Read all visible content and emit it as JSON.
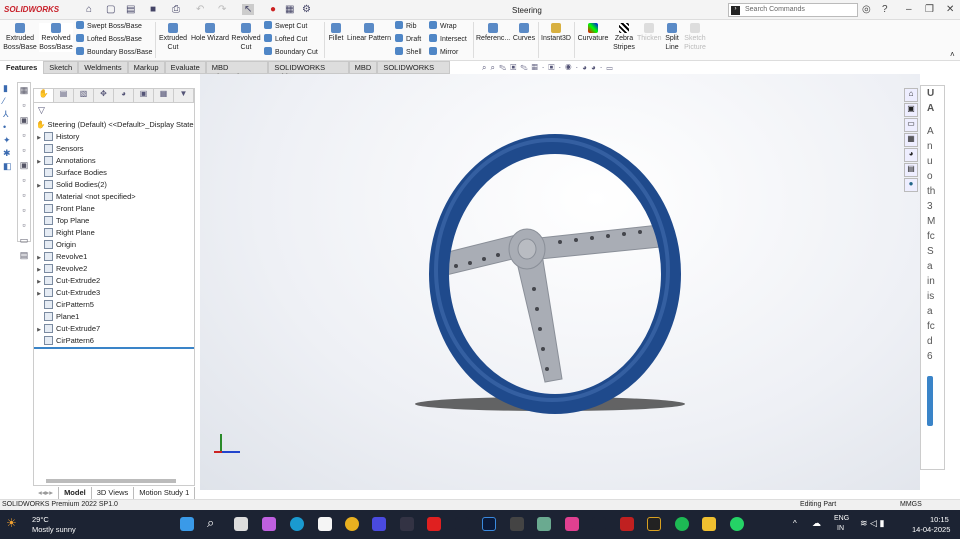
{
  "app": {
    "logo": "SOLIDWORKS",
    "title": "Steering",
    "search_placeholder": "Search Commands"
  },
  "ribbon": {
    "big": [
      "Extruded Boss/Base",
      "Revolved Boss/Base",
      "Extruded Cut",
      "Hole Wizard",
      "Revolved Cut",
      "Fillet",
      "Linear Pattern",
      "Referenc...",
      "Curves",
      "Instant3D",
      "Curvature",
      "Zebra Stripes",
      "Thicken",
      "Split Line",
      "Sketch Picture"
    ],
    "small": [
      "Swept Boss/Base",
      "Lofted Boss/Base",
      "Boundary Boss/Base",
      "Swept Cut",
      "Lofted Cut",
      "Boundary Cut",
      "Rib",
      "Draft",
      "Shell",
      "Wrap",
      "Intersect",
      "Mirror"
    ]
  },
  "tabs": [
    "Features",
    "Sketch",
    "Weldments",
    "Markup",
    "Evaluate",
    "MBD Dimensions",
    "SOLIDWORKS Add-Ins",
    "MBD",
    "SOLIDWORKS CAM"
  ],
  "tree": {
    "root": "Steering (Default) <<Default>_Display State",
    "nodes": [
      {
        "label": "History",
        "exp": true
      },
      {
        "label": "Sensors",
        "exp": false
      },
      {
        "label": "Annotations",
        "exp": true
      },
      {
        "label": "Surface Bodies",
        "exp": false
      },
      {
        "label": "Solid Bodies(2)",
        "exp": true
      },
      {
        "label": "Material <not specified>",
        "exp": false
      },
      {
        "label": "Front Plane",
        "exp": false
      },
      {
        "label": "Top Plane",
        "exp": false
      },
      {
        "label": "Right Plane",
        "exp": false
      },
      {
        "label": "Origin",
        "exp": false
      },
      {
        "label": "Revolve1",
        "exp": true
      },
      {
        "label": "Revolve2",
        "exp": true
      },
      {
        "label": "Cut-Extrude2",
        "exp": true
      },
      {
        "label": "Cut-Extrude3",
        "exp": true
      },
      {
        "label": "CirPattern5",
        "exp": false
      },
      {
        "label": "Plane1",
        "exp": false
      },
      {
        "label": "Cut-Extrude7",
        "exp": true
      },
      {
        "label": "CirPattern6",
        "exp": false
      }
    ]
  },
  "bottom_tabs": [
    "Model",
    "3D Views",
    "Motion Study 1"
  ],
  "status": {
    "left": "SOLIDWORKS Premium 2022 SP1.0",
    "mode": "Editing Part",
    "units": "MMGS"
  },
  "right_panel": {
    "lines": [
      "U",
      "A",
      "A",
      "n",
      "u",
      "o",
      "th",
      "3",
      "M",
      "fc",
      "S",
      "a",
      "in",
      "is",
      "a",
      "fc",
      "d",
      "6"
    ]
  },
  "taskbar": {
    "temp": "29°C",
    "weather": "Mostly sunny",
    "lang": "ENG",
    "region": "IN",
    "time": "10:15",
    "date": "14-04-2025"
  },
  "colors": {
    "wheel": "#1f4a8c",
    "spoke": "#a9adb5"
  }
}
